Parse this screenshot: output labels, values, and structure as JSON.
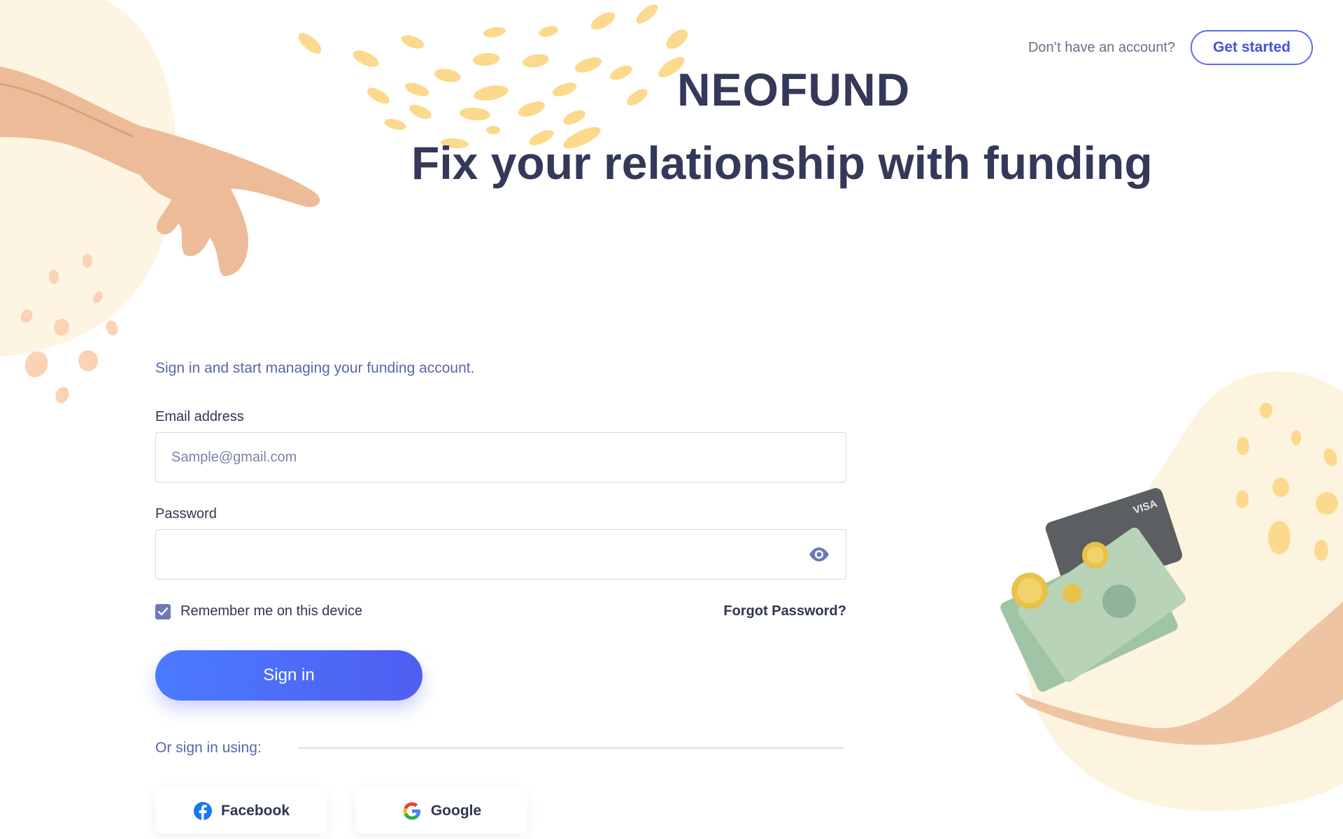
{
  "header": {
    "signup_prompt": "Don’t have an account?",
    "get_started_label": "Get started"
  },
  "brand": {
    "name": "NEOFUND"
  },
  "hero": {
    "headline": "Fix your relationship with funding"
  },
  "form": {
    "subtitle": "Sign in and start managing your funding account.",
    "email_label": "Email address",
    "email_placeholder": "Sample@gmail.com",
    "email_value": "",
    "password_label": "Password",
    "password_value": "",
    "remember_label": "Remember me on this device",
    "remember_checked": true,
    "forgot_label": "Forgot Password?",
    "submit_label": "Sign in",
    "alt_signin_label": "Or sign in using:"
  },
  "social": [
    {
      "label": "Facebook",
      "icon": "facebook-icon"
    },
    {
      "label": "Google",
      "icon": "google-icon"
    }
  ],
  "colors": {
    "accent": "#4f5ef2",
    "heading": "#34395a",
    "blob": "#fdf4df",
    "leaf": "#fcd98c"
  }
}
